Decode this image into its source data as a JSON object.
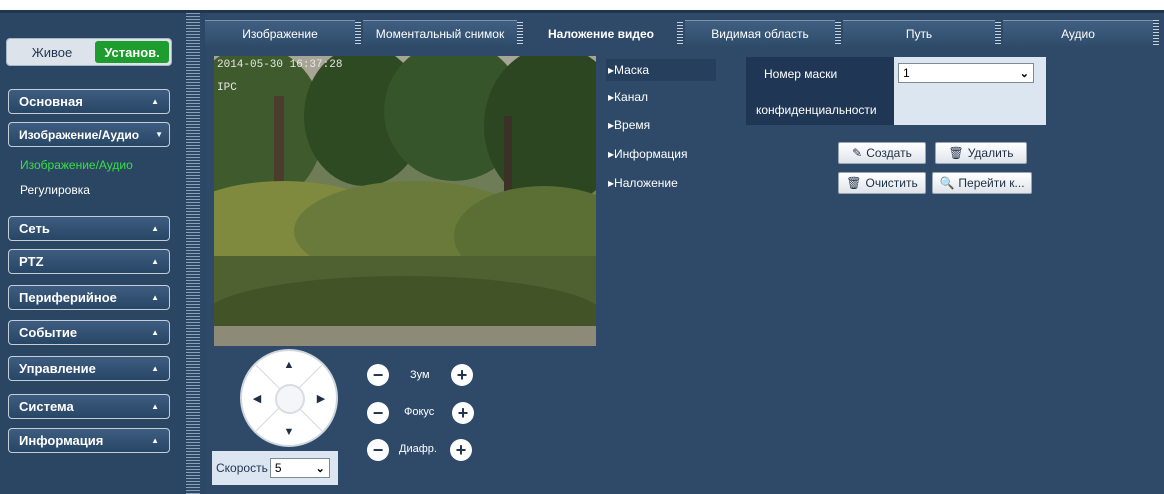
{
  "mode": {
    "live_label": "Живое",
    "setup_label": "Установ."
  },
  "sidebar": {
    "basic": "Основная",
    "image_audio": "Изображение/Аудио",
    "image_audio_sub": "Изображение/Аудио",
    "adjust_sub": "Регулировка",
    "network": "Сеть",
    "ptz": "PTZ",
    "peripheral": "Периферийное",
    "event": "Событие",
    "management": "Управление",
    "system": "Система",
    "info": "Информация"
  },
  "tabs": {
    "image": "Изображение",
    "snapshot": "Моментальный снимок",
    "overlay": "Наложение видео",
    "roi": "Видимая область",
    "path": "Путь",
    "audio": "Аудио"
  },
  "video": {
    "timestamp": "2014-05-30 16:37:28",
    "channel_name": "IPC"
  },
  "ptz": {
    "zoom_label": "Зум",
    "focus_label": "Фокус",
    "iris_label": "Диафр.",
    "speed_label": "Скорость",
    "speed_value": "5"
  },
  "subnav": {
    "mask": "Маска",
    "channel": "Канал",
    "time": "Время",
    "information": "Информация",
    "overlay": "Наложение"
  },
  "mask_form": {
    "label_line1": "Номер маски",
    "label_line2": "конфиденциальности",
    "selected": "1"
  },
  "actions": {
    "create": "Создать",
    "delete": "Удалить",
    "clear": "Очистить",
    "goto": "Перейти к..."
  },
  "colors": {
    "accent_green": "#1e9c2d",
    "active_submenu": "#35e043",
    "background": "#2f4a68"
  }
}
